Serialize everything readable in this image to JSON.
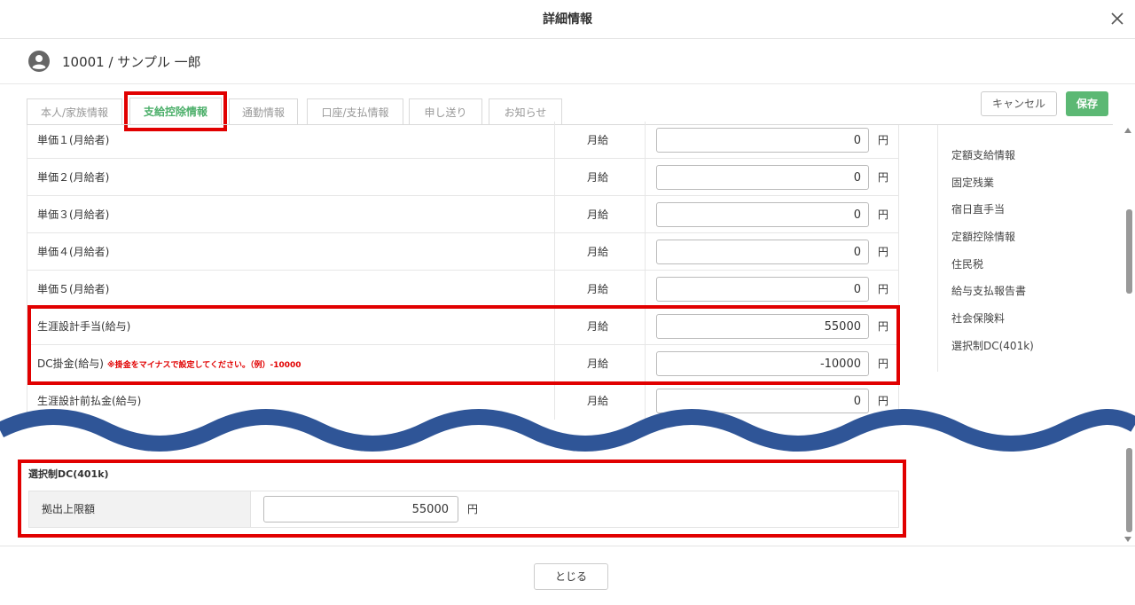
{
  "dialog": {
    "title": "詳細情報"
  },
  "employee": {
    "label": "10001 / サンプル 一郎"
  },
  "tabs": [
    {
      "label": "本人/家族情報"
    },
    {
      "label": "支給控除情報"
    },
    {
      "label": "通勤情報"
    },
    {
      "label": "口座/支払情報"
    },
    {
      "label": "申し送り"
    },
    {
      "label": "お知らせ"
    }
  ],
  "actions": {
    "cancel": "キャンセル",
    "save": "保存"
  },
  "rows": [
    {
      "label": "単価１(月給者)",
      "kind": "月給",
      "value": "0",
      "unit": "円"
    },
    {
      "label": "単価２(月給者)",
      "kind": "月給",
      "value": "0",
      "unit": "円"
    },
    {
      "label": "単価３(月給者)",
      "kind": "月給",
      "value": "0",
      "unit": "円"
    },
    {
      "label": "単価４(月給者)",
      "kind": "月給",
      "value": "0",
      "unit": "円"
    },
    {
      "label": "単価５(月給者)",
      "kind": "月給",
      "value": "0",
      "unit": "円"
    },
    {
      "label": "生涯設計手当(給与)",
      "kind": "月給",
      "value": "55000",
      "unit": "円"
    },
    {
      "label": "DC掛金(給与)",
      "note": "※掛金をマイナスで設定してください。（例）-10000",
      "kind": "月給",
      "value": "-10000",
      "unit": "円"
    },
    {
      "label": "生涯設計前払金(給与)",
      "kind": "月給",
      "value": "0",
      "unit": "円"
    }
  ],
  "side_nav": [
    {
      "label": "定額支給情報"
    },
    {
      "label": "固定残業"
    },
    {
      "label": "宿日直手当"
    },
    {
      "label": "定額控除情報"
    },
    {
      "label": "住民税"
    },
    {
      "label": "給与支払報告書"
    },
    {
      "label": "社会保険料"
    },
    {
      "label": "選択制DC(401k)"
    }
  ],
  "dc_section": {
    "title": "選択制DC(401k)",
    "limit_label": "拠出上限額",
    "limit_value": "55000",
    "unit": "円"
  },
  "footer": {
    "close": "とじる"
  },
  "colors": {
    "accent_green": "#5cb874",
    "highlight_red": "#e10000",
    "wave_blue": "#2f5597"
  }
}
